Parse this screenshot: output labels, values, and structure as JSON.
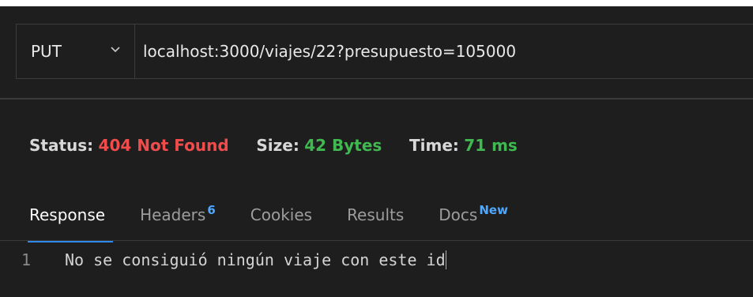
{
  "request": {
    "method": "PUT",
    "url": "localhost:3000/viajes/22?presupuesto=105000"
  },
  "status": {
    "status_label": "Status:",
    "status_value": "404 Not Found",
    "size_label": "Size:",
    "size_value": "42 Bytes",
    "time_label": "Time:",
    "time_value": "71 ms"
  },
  "tabs": [
    {
      "label": "Response",
      "badge": ""
    },
    {
      "label": "Headers",
      "badge": "6"
    },
    {
      "label": "Cookies",
      "badge": ""
    },
    {
      "label": "Results",
      "badge": ""
    },
    {
      "label": "Docs",
      "badge": "New"
    }
  ],
  "editor": {
    "line_number": "1",
    "content": "No se consiguió ningún viaje con este id"
  },
  "icons": {
    "method_dropdown": "chevron-down-icon"
  },
  "colors": {
    "background": "#1e1e1e",
    "error": "#f14c4c",
    "success": "#3fb950",
    "accent": "#2f89e8"
  }
}
